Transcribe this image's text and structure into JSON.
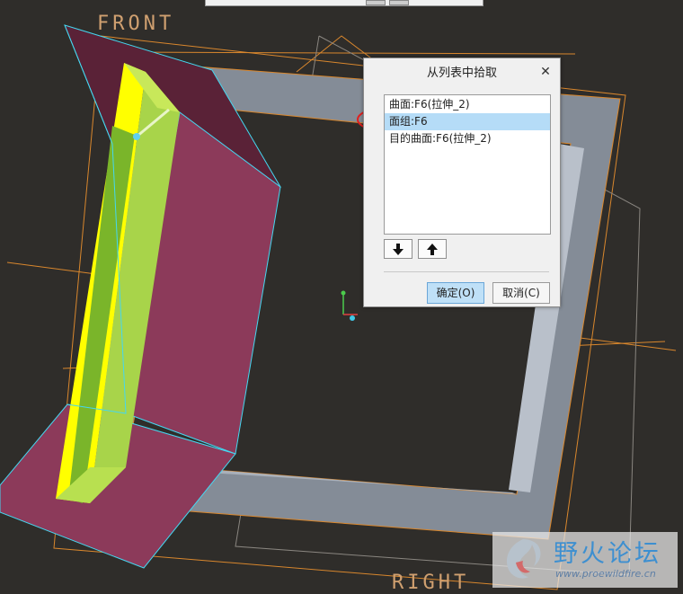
{
  "viewport": {
    "datum_front_label": "FRONT",
    "datum_right_label": "RIGHT",
    "colors": {
      "background": "#2f2d2a",
      "datum_plane": "#d9872d",
      "surface_magenta": "#8c3a5a",
      "surface_yellow": "#ffff00",
      "surface_green": "#a8d44a",
      "frame_gray": "#8a929c",
      "highlight_cyan": "#45d7f0"
    }
  },
  "dialog": {
    "title": "从列表中拾取",
    "items": [
      {
        "label": "曲面:F6(拉伸_2)",
        "selected": false
      },
      {
        "label": "面组:F6",
        "selected": true
      },
      {
        "label": "目的曲面:F6(拉伸_2)",
        "selected": false
      }
    ],
    "ok_label": "确定(O)",
    "cancel_label": "取消(C)"
  },
  "watermark": {
    "title": "野火论坛",
    "url": "www.proewildfire.cn"
  }
}
